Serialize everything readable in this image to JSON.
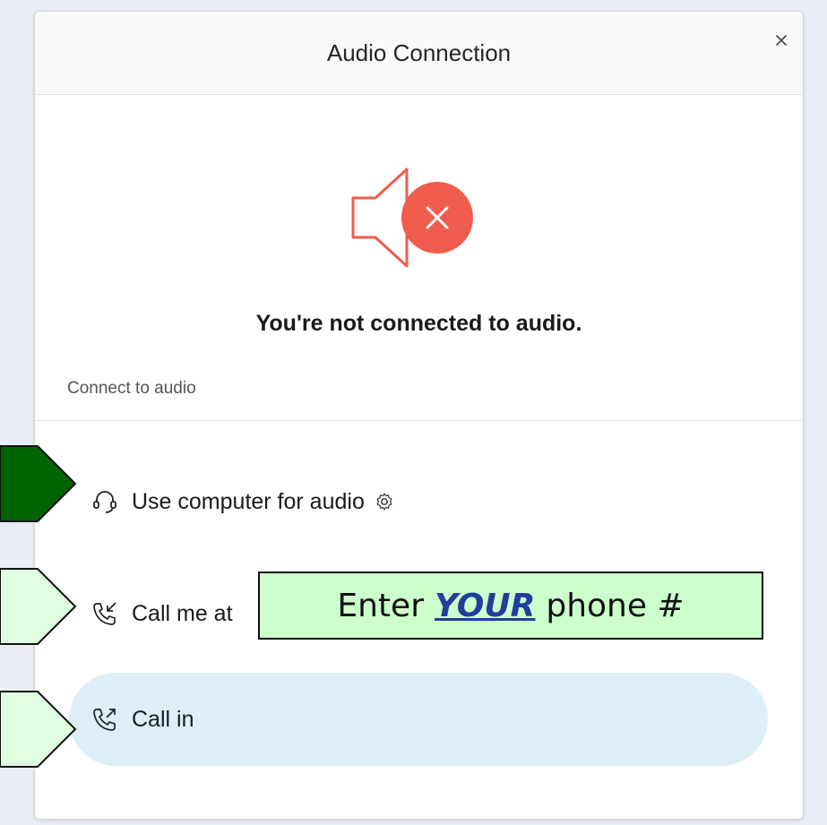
{
  "dialog": {
    "title": "Audio Connection",
    "status_message": "You're not connected to audio.",
    "section_label": "Connect to audio",
    "options": [
      {
        "label": "Use computer for audio",
        "icon": "headset-icon",
        "selected": false
      },
      {
        "label": "Call me at",
        "icon": "phone-incoming-icon",
        "selected": false
      },
      {
        "label": "Call in",
        "icon": "phone-outgoing-icon",
        "selected": true
      }
    ]
  },
  "annotation": {
    "callout_prefix": "Enter",
    "callout_emphasis": "YOUR",
    "callout_suffix": "phone #"
  },
  "colors": {
    "muted_speaker": "#f05d4e",
    "selected_option_bg": "#ddeef8",
    "arrow_dark_green": "#006400",
    "arrow_light_green": "#e0ffe0",
    "callout_bg": "#ccffcc"
  }
}
